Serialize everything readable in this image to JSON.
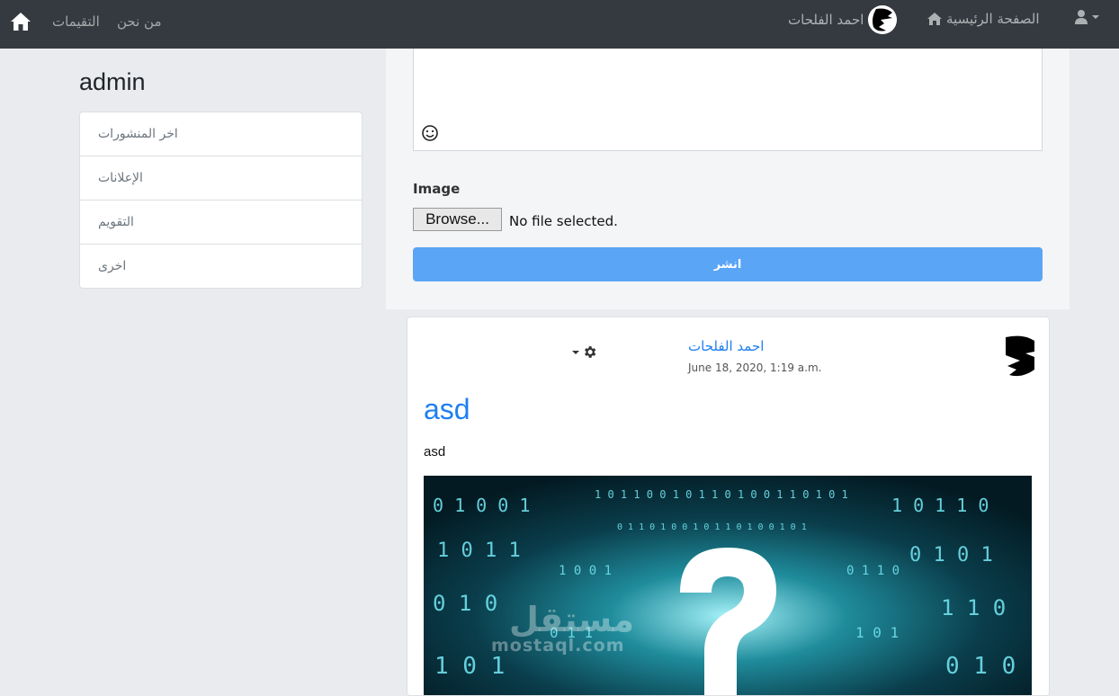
{
  "nav": {
    "links": [
      "التقيمات",
      "من نحن"
    ],
    "user_name": "احمد الفلحات",
    "home_label": "الصفحة الرئيسية",
    "icons": [
      "home-icon",
      "user-icon",
      "caret-down-icon"
    ]
  },
  "sidebar": {
    "title": "admin",
    "items": [
      {
        "label": "اخر المنشورات"
      },
      {
        "label": "الإعلانات"
      },
      {
        "label": "التقويم"
      },
      {
        "label": "اخرى"
      }
    ]
  },
  "compose": {
    "image_label": "Image",
    "browse_label": "Browse...",
    "file_status": "No file selected.",
    "publish_label": "انشر"
  },
  "post": {
    "author": "احمد الفلحات",
    "date": "June 18, 2020, 1:19 a.m.",
    "title": "asd",
    "body": "asd",
    "watermark_ar": "مستقل",
    "watermark_en": "mostaql.com"
  },
  "colors": {
    "navbar": "#343a40",
    "accent": "#1e7ff0",
    "publish_button": "#5aa5f5"
  }
}
